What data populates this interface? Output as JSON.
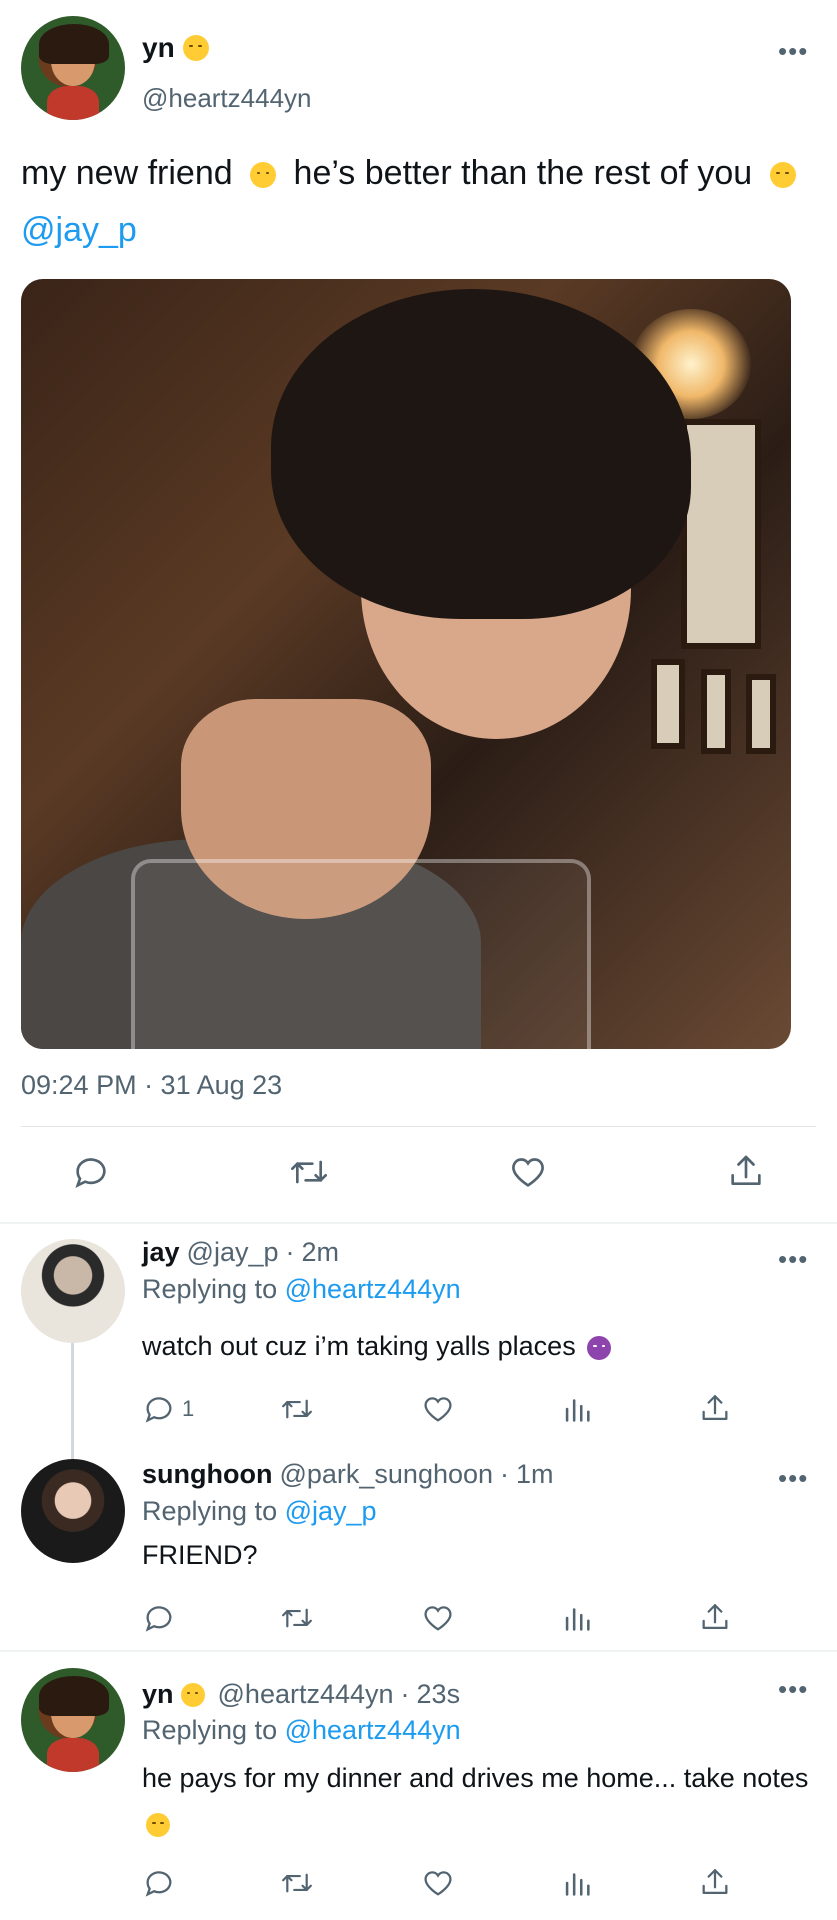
{
  "main_tweet": {
    "display_name": "yn",
    "name_emoji": "upside-down-face-emoji",
    "handle": "@heartz444yn",
    "text_part1": "my new friend",
    "text_emoji1": "hugging-face-emoji",
    "text_part2": "he’s better than the rest of you",
    "text_emoji2": "unamused-face-emoji",
    "text_mention": "@jay_p",
    "timestamp": "09:24 PM · 31 Aug 23",
    "more": "•••",
    "actions": [
      "reply-icon",
      "retweet-icon",
      "like-icon",
      "share-icon"
    ]
  },
  "replies": [
    {
      "display_name": "jay",
      "handle": "@jay_p",
      "dot": "·",
      "time": "2m",
      "replying_prefix": "Replying to",
      "replying_to": "@heartz444yn",
      "text": "watch out cuz i’m taking yalls places",
      "text_emoji": "smiling-devil-emoji",
      "reply_count": "1",
      "more": "•••"
    },
    {
      "display_name": "sunghoon",
      "handle": "@park_sunghoon",
      "dot": "·",
      "time": "1m",
      "replying_prefix": "Replying to",
      "replying_to": "@jay_p",
      "text": "FRIEND?",
      "reply_count": "",
      "more": "•••"
    },
    {
      "display_name": "yn",
      "name_emoji": "upside-down-face-emoji",
      "handle": "@heartz444yn",
      "dot": "·",
      "time": "23s",
      "replying_prefix": "Replying to",
      "replying_to": "@heartz444yn",
      "text": "he pays for my dinner and drives me home... take notes",
      "text_emoji": "unamused-face-emoji",
      "reply_count": "",
      "more": "•••"
    }
  ],
  "colors": {
    "link": "#1d9bf0",
    "secondary_text": "#536471",
    "primary_text": "#0f1419",
    "divider": "#eff3f4"
  }
}
